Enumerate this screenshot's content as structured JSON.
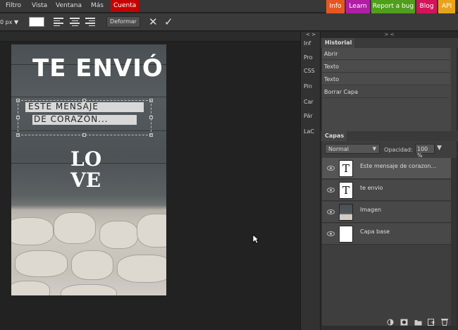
{
  "menu": {
    "items": [
      "Filtro",
      "Vista",
      "Ventana",
      "Más"
    ],
    "active": "Cuenta",
    "links": [
      {
        "label": "Info",
        "color": "#e8561f"
      },
      {
        "label": "Learn",
        "color": "#b01ea6"
      },
      {
        "label": "Report a bug",
        "color": "#4f9e1c"
      },
      {
        "label": "Blog",
        "color": "#d4145a"
      },
      {
        "label": "API",
        "color": "#e8a317"
      }
    ]
  },
  "toolbar": {
    "font_size": "0 px ▼",
    "deform_label": "Deformar",
    "cancel_glyph": "✕",
    "confirm_glyph": "✓"
  },
  "canvas": {
    "title_text": "TE ENVIÓ",
    "message_line1": "ESTE MENSAJE",
    "message_line2": "DE CORAZÓN...",
    "love_top": "LO",
    "love_bottom": "VE"
  },
  "side_tabs": [
    "Inf",
    "Pro",
    "CSS",
    "Pin",
    "Car",
    "Pár",
    "LaC"
  ],
  "history": {
    "tab_label": "Historial",
    "grip": "> <",
    "items": [
      "Abrir",
      "Texto",
      "Texto",
      "Borrar Capa"
    ]
  },
  "layers": {
    "tab_label": "Capas",
    "blend_mode": "Normal",
    "opacity_label": "Opacidad:",
    "opacity_value": "100 %",
    "items": [
      {
        "name": "Este mensaje de corazon...",
        "thumb": "T"
      },
      {
        "name": "te envio",
        "thumb": "T"
      },
      {
        "name": "Imagen",
        "thumb": ""
      },
      {
        "name": "Capa base",
        "thumb": ""
      }
    ]
  },
  "side_grip": "< >"
}
